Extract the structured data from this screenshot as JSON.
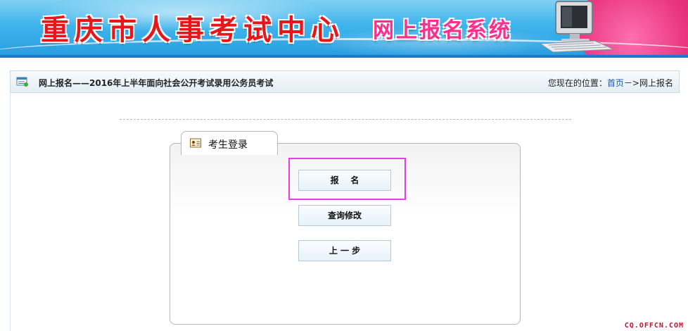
{
  "banner": {
    "title": "重庆市人事考试中心",
    "subtitle": "网上报名系统"
  },
  "breadcrumb": {
    "page_title": "网上报名——2016年上半年面向社会公开考试录用公务员考试",
    "location_prefix": "您现在的位置：",
    "home_link": "首页",
    "separator": "－>",
    "current": "网上报名"
  },
  "login_panel": {
    "tab_label": "考生登录",
    "buttons": [
      {
        "label": "报    名"
      },
      {
        "label": "查询修改"
      },
      {
        "label": "上 一 步"
      }
    ]
  },
  "watermark": "CQ.OFFCN.COM",
  "colors": {
    "banner_blue": "#2a9fe0",
    "title_red": "#e8151b",
    "subtitle_pink": "#ff2d8e",
    "highlight_magenta": "#e33ee6",
    "link_blue": "#1a56b5"
  },
  "icons": {
    "banner": "computer-monitor-icon",
    "breadcrumb": "list-window-icon",
    "tab": "id-card-icon"
  }
}
